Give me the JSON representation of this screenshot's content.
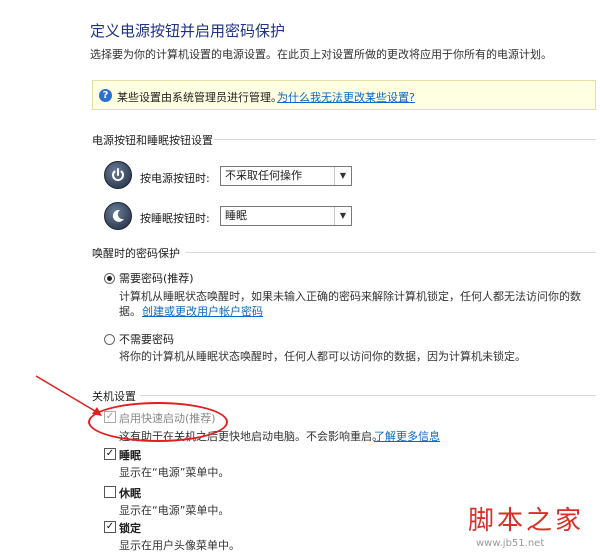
{
  "header": {
    "title": "定义电源按钮并启用密码保护",
    "description": "选择要为你的计算机设置的电源设置。在此页上对设置所做的更改将应用于你所有的电源计划。"
  },
  "notice": {
    "icon": "shield-question-icon",
    "text": "某些设置由系统管理员进行管理。",
    "link": "为什么我无法更改某些设置?"
  },
  "power_section": {
    "title": "电源按钮和睡眠按钮设置",
    "power_button": {
      "label": "按电源按钮时:",
      "value": "不采取任何操作"
    },
    "sleep_button": {
      "label": "按睡眠按钮时:",
      "value": "睡眠"
    }
  },
  "wake_section": {
    "title": "唤醒时的密码保护",
    "require": {
      "label": "需要密码(推荐)",
      "desc_line1": "计算机从睡眠状态唤醒时，如果未输入正确的密码来解除计算机锁定，任何人都无法访问你的数",
      "desc_line2": "据。",
      "link": "创建或更改用户帐户密码"
    },
    "no_require": {
      "label": "不需要密码",
      "desc": "将你的计算机从睡眠状态唤醒时，任何人都可以访问你的数据，因为计算机未锁定。"
    }
  },
  "shutdown_section": {
    "title": "关机设置",
    "fast_startup": {
      "label": "启用快速启动(推荐)",
      "desc": "这有助于在关机之后更快地启动电脑。不会影响重启。",
      "link": "了解更多信息"
    },
    "sleep": {
      "label": "睡眠",
      "desc": "显示在“电源”菜单中。"
    },
    "hibernate": {
      "label": "休眠",
      "desc": "显示在“电源”菜单中。"
    },
    "lock": {
      "label": "锁定",
      "desc": "显示在用户头像菜单中。"
    }
  },
  "watermark": {
    "site_cn": "脚本之家",
    "site_url": "www.jb51.net"
  },
  "colors": {
    "title_blue": "#1e3287",
    "link_blue": "#0b68c4",
    "notice_bg": "#ffffe1",
    "annotation_red": "#e02020"
  }
}
